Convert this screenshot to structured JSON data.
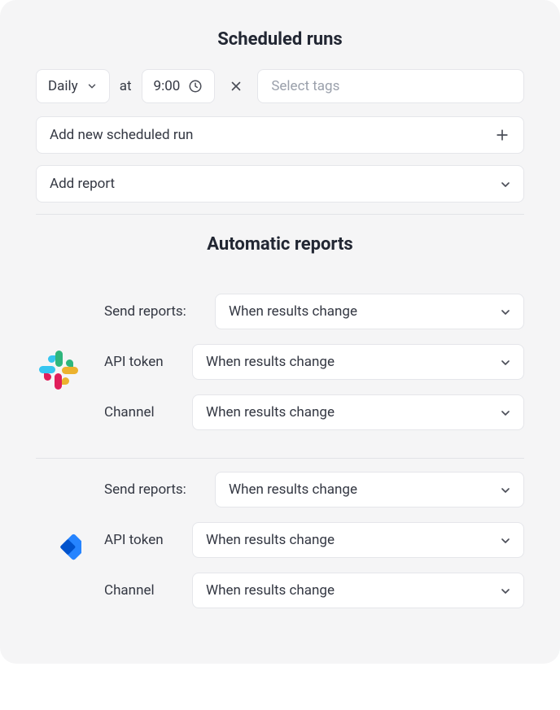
{
  "scheduled": {
    "title": "Scheduled runs",
    "frequency": "Daily",
    "at_label": "at",
    "time": "9:00",
    "tags_placeholder": "Select tags",
    "add_run_label": "Add new scheduled run",
    "add_report_label": "Add report"
  },
  "automatic": {
    "title": "Automatic reports",
    "integrations": [
      {
        "id": "slack",
        "send_reports_label": "Send reports:",
        "send_reports_value": "When results change",
        "api_token_label": "API token",
        "api_token_value": "When results change",
        "channel_label": "Channel",
        "channel_value": "When results change"
      },
      {
        "id": "jira",
        "send_reports_label": "Send reports:",
        "send_reports_value": "When results change",
        "api_token_label": "API token",
        "api_token_value": "When results change",
        "channel_label": "Channel",
        "channel_value": "When results change"
      }
    ]
  }
}
